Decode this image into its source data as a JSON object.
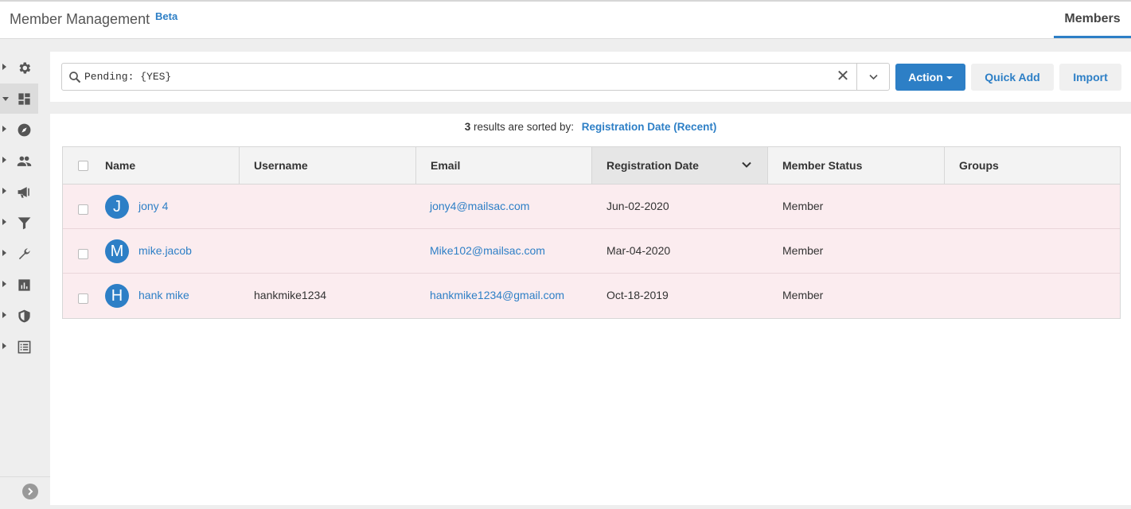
{
  "header": {
    "title": "Member Management",
    "badge": "Beta",
    "tab": "Members"
  },
  "sidebar": {
    "items": [
      {
        "icon": "gear-icon",
        "active": false
      },
      {
        "icon": "dashboard-icon",
        "active": true
      },
      {
        "icon": "compass-icon",
        "active": false
      },
      {
        "icon": "people-icon",
        "active": false
      },
      {
        "icon": "megaphone-icon",
        "active": false
      },
      {
        "icon": "filter-icon",
        "active": false
      },
      {
        "icon": "wrench-icon",
        "active": false
      },
      {
        "icon": "bar-chart-icon",
        "active": false
      },
      {
        "icon": "shield-icon",
        "active": false
      },
      {
        "icon": "list-icon",
        "active": false
      }
    ]
  },
  "search": {
    "value": "Pending: {YES}",
    "clear": "✕"
  },
  "toolbar": {
    "action_label": "Action",
    "quick_add_label": "Quick Add",
    "import_label": "Import"
  },
  "results": {
    "count": "3",
    "sorted_text": " results are sorted by:",
    "sort_field": "Registration Date (Recent)"
  },
  "table": {
    "columns": [
      "Name",
      "Username",
      "Email",
      "Registration Date",
      "Member Status",
      "Groups"
    ],
    "rows": [
      {
        "initial": "J",
        "name": "jony 4",
        "username": "",
        "email": "jony4@mailsac.com",
        "date": "Jun-02-2020",
        "status": "Member",
        "groups": ""
      },
      {
        "initial": "M",
        "name": "mike.jacob",
        "username": "",
        "email": "Mike102@mailsac.com",
        "date": "Mar-04-2020",
        "status": "Member",
        "groups": ""
      },
      {
        "initial": "H",
        "name": "hank mike",
        "username": "hankmike1234",
        "email": "hankmike1234@gmail.com",
        "date": "Oct-18-2019",
        "status": "Member",
        "groups": ""
      }
    ]
  },
  "colors": {
    "accent": "#2d7fc6",
    "row_highlight": "#fbecef"
  }
}
